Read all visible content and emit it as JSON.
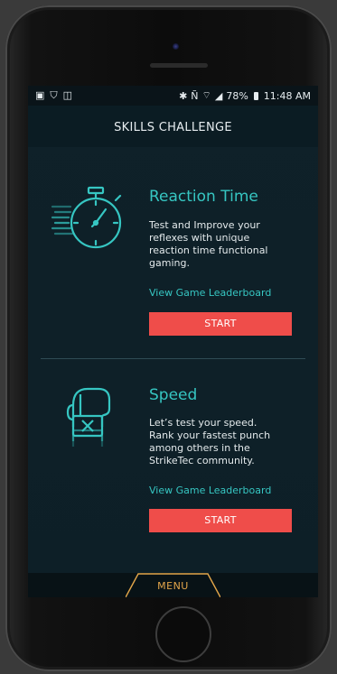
{
  "status_bar": {
    "left_icons": [
      "image-icon",
      "shield-icon",
      "alarm-icon"
    ],
    "right_icons": [
      "bluetooth-icon",
      "nfc-icon",
      "wifi-icon",
      "signal-icon"
    ],
    "battery": "78%",
    "time": "11:48 AM"
  },
  "header": {
    "title": "SKILLS CHALLENGE"
  },
  "games": [
    {
      "title": "Reaction Time",
      "description_lines": [
        "Test and Improve your",
        "reflexes with unique",
        "reaction time functional",
        "gaming."
      ],
      "link": "View Game Leaderboard",
      "button": "START",
      "icon": "stopwatch-icon"
    },
    {
      "title": "Speed",
      "description_lines": [
        "Let’s test your speed.",
        "Rank your fastest punch",
        "among others in the",
        "StrikeTec community."
      ],
      "link": "View Game Leaderboard",
      "button": "START",
      "icon": "boxing-glove-icon"
    }
  ],
  "menu": {
    "label": "MENU"
  },
  "colors": {
    "accent": "#36c6c2",
    "button": "#ef4d4a",
    "menu": "#e3a64a",
    "background": "#0f2129"
  }
}
